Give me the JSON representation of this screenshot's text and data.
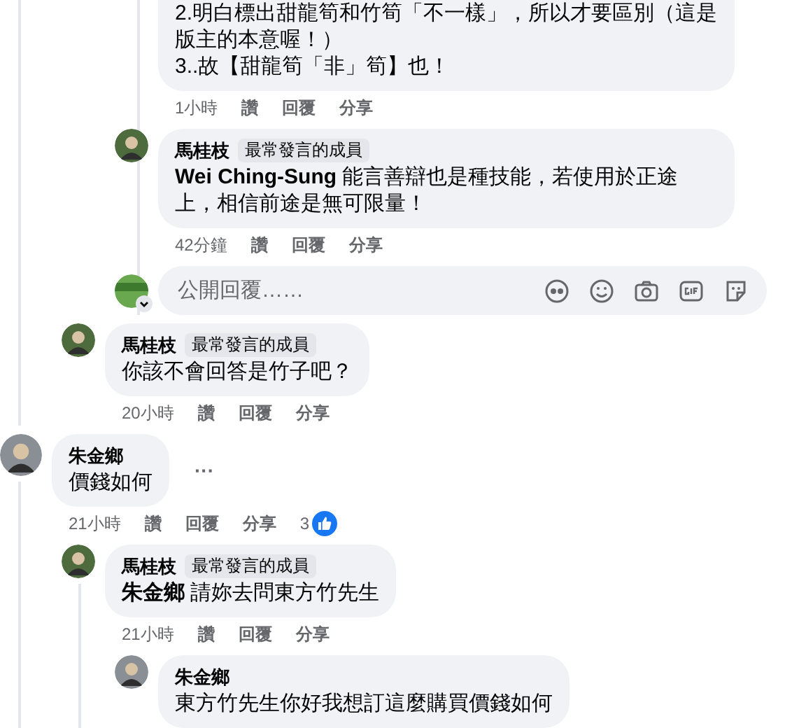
{
  "comments": [
    {
      "kind": "continuation",
      "children": [
        {
          "kind": "continuation",
          "children": [
            {
              "kind": "comment",
              "text": "2.明白標出甜龍筍和竹筍「不一樣」，所以才要區別（這是版主的本意喔！）\n3..故【甜龍筍「非」筍】也！",
              "time": "1小時",
              "actions": [
                "讚",
                "回覆",
                "分享"
              ]
            },
            {
              "kind": "comment",
              "author": "馬桂枝",
              "badge": "最常發言的成員",
              "color": "#4d6b3c",
              "text": "**Wei Ching-Sung** 能言善辯也是種技能，若使用於正途上，相信前途是無可限量！",
              "time": "42分鐘",
              "actions": [
                "讚",
                "回覆",
                "分享"
              ]
            },
            {
              "kind": "reply_box",
              "color": "#6aa84f",
              "placeholder": "公開回覆……"
            }
          ]
        },
        {
          "kind": "comment",
          "author": "馬桂枝",
          "badge": "最常發言的成員",
          "color": "#4d6b3c",
          "text": "你該不會回答是竹子吧？",
          "time": "20小時",
          "actions": [
            "讚",
            "回覆",
            "分享"
          ]
        }
      ]
    },
    {
      "kind": "comment",
      "author": "朱金鄉",
      "color": "#8a8f96",
      "text": "價錢如何",
      "more": "···",
      "time": "21小時",
      "actions": [
        "讚",
        "回覆",
        "分享"
      ],
      "likes": "3",
      "children": [
        {
          "kind": "comment",
          "author": "馬桂枝",
          "badge": "最常發言的成員",
          "color": "#4d6b3c",
          "text": "**朱金鄉** 請妳去問東方竹先生",
          "time": "21小時",
          "actions": [
            "讚",
            "回覆",
            "分享"
          ],
          "children": [
            {
              "kind": "comment",
              "author": "朱金鄉",
              "color": "#8a8f96",
              "text": "東方竹先生你好我想訂這麼購買價錢如何"
            }
          ]
        }
      ]
    }
  ]
}
